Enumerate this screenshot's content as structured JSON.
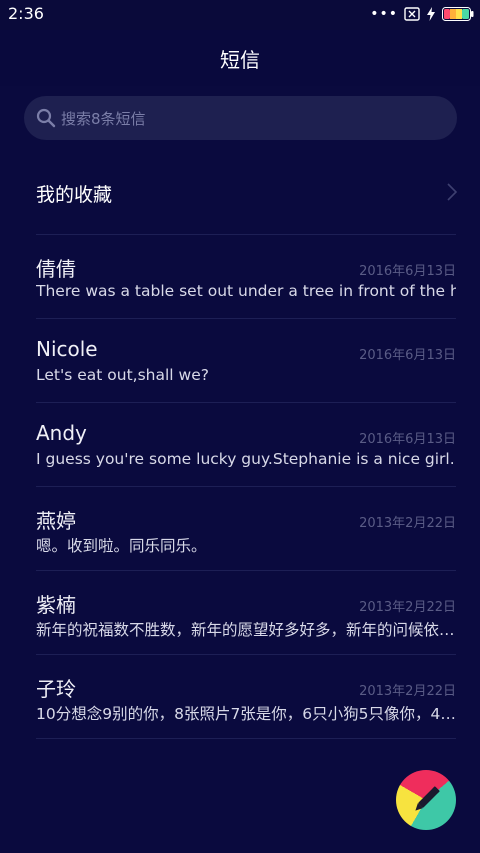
{
  "status_bar": {
    "time": "2:36",
    "icons": [
      "more-dots-icon",
      "sim-off-icon",
      "charging-bolt-icon",
      "battery-icon"
    ]
  },
  "header": {
    "title": "短信"
  },
  "search": {
    "placeholder": "搜索8条短信",
    "icon": "search-icon"
  },
  "favorites": {
    "label": "我的收藏",
    "icon": "chevron-right-icon"
  },
  "threads": [
    {
      "name": "倩倩",
      "date": "2016年6月13日",
      "preview": "There was a table set out under a tree in front of the hous"
    },
    {
      "name": "Nicole",
      "date": "2016年6月13日",
      "preview": "Let's eat out,shall we?"
    },
    {
      "name": "Andy",
      "date": "2016年6月13日",
      "preview": "I guess you're some lucky guy.Stephanie is a nice girl."
    },
    {
      "name": "燕婷",
      "date": "2013年2月22日",
      "preview": "嗯。收到啦。同乐同乐。"
    },
    {
      "name": "紫楠",
      "date": "2013年2月22日",
      "preview": "新年的祝福数不胜数，新年的愿望好多好多，新年的问候依…"
    },
    {
      "name": "子玲",
      "date": "2013年2月22日",
      "preview": "10分想念9别的你，8张照片7张是你，6只小狗5只像你，4…"
    }
  ],
  "compose_button": {
    "icon": "pencil-icon"
  },
  "colors": {
    "background": "#0a0a3e",
    "search_bg": "#1e2050",
    "date_text": "#5a5c86",
    "compose_yellow": "#f7e33f",
    "compose_red": "#ef2d5c",
    "compose_teal": "#3ec8a7"
  }
}
